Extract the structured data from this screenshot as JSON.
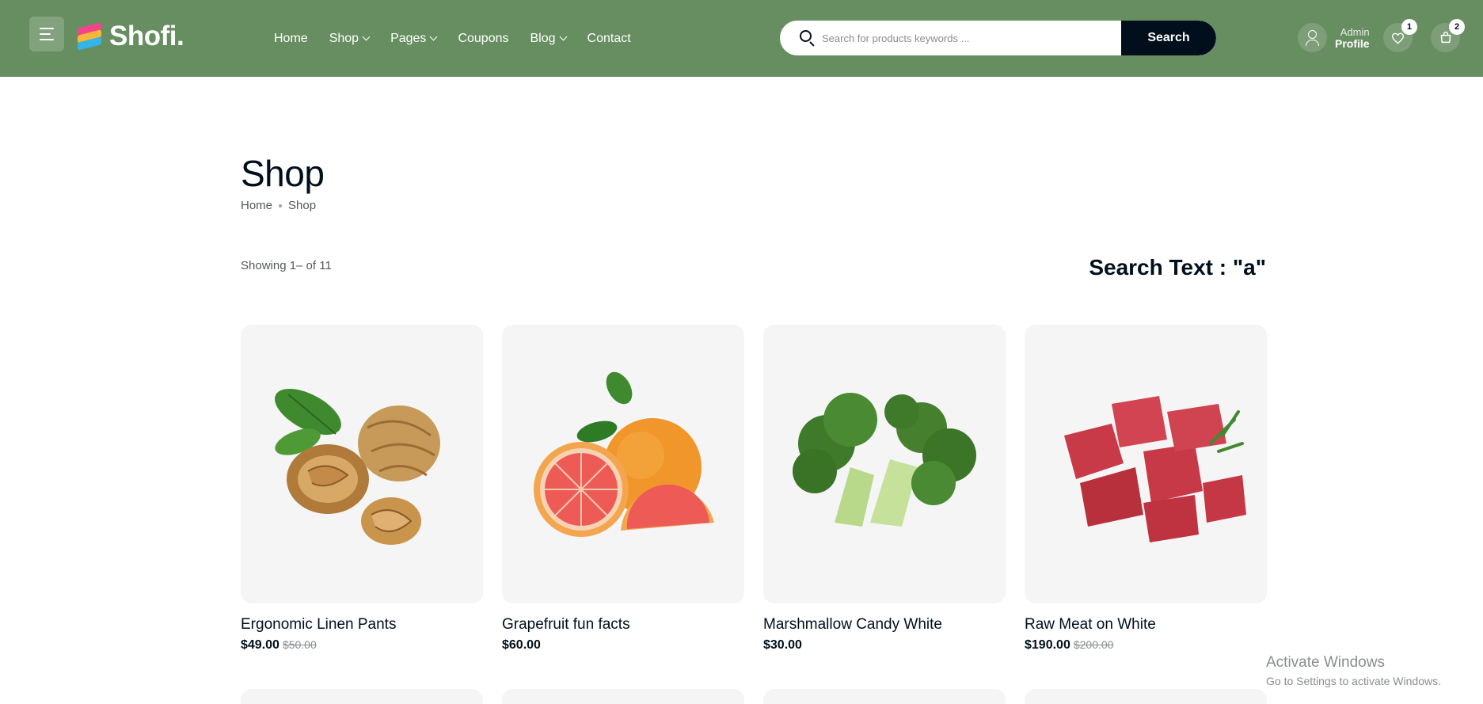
{
  "brand": {
    "name": "Shofi."
  },
  "nav": {
    "items": [
      {
        "label": "Home",
        "dropdown": false
      },
      {
        "label": "Shop",
        "dropdown": true
      },
      {
        "label": "Pages",
        "dropdown": true
      },
      {
        "label": "Coupons",
        "dropdown": false
      },
      {
        "label": "Blog",
        "dropdown": true
      },
      {
        "label": "Contact",
        "dropdown": false
      }
    ]
  },
  "search": {
    "placeholder": "Search for products keywords ...",
    "value": "",
    "button_label": "Search"
  },
  "profile": {
    "top_label": "Admin",
    "bottom_label": "Profile"
  },
  "wishlist": {
    "count": "1"
  },
  "cart": {
    "count": "2"
  },
  "page": {
    "title": "Shop",
    "breadcrumb": [
      "Home",
      "Shop"
    ],
    "showing_text": "Showing 1– of 11",
    "search_text": "Search Text : \"a\""
  },
  "products": [
    {
      "title": "Ergonomic Linen Pants",
      "price": "$49.00",
      "old_price": "$50.00",
      "image": "walnuts"
    },
    {
      "title": "Grapefruit fun facts",
      "price": "$60.00",
      "old_price": "",
      "image": "grapefruit"
    },
    {
      "title": "Marshmallow Candy White",
      "price": "$30.00",
      "old_price": "",
      "image": "broccoli"
    },
    {
      "title": "Raw Meat on White",
      "price": "$190.00",
      "old_price": "$200.00",
      "image": "raw-meat"
    }
  ],
  "windows_watermark": {
    "line1": "Activate Windows",
    "line2": "Go to Settings to activate Windows."
  },
  "colors": {
    "header_bg": "#678e61",
    "dark": "#010f1c",
    "card_bg": "#f5f5f5"
  }
}
